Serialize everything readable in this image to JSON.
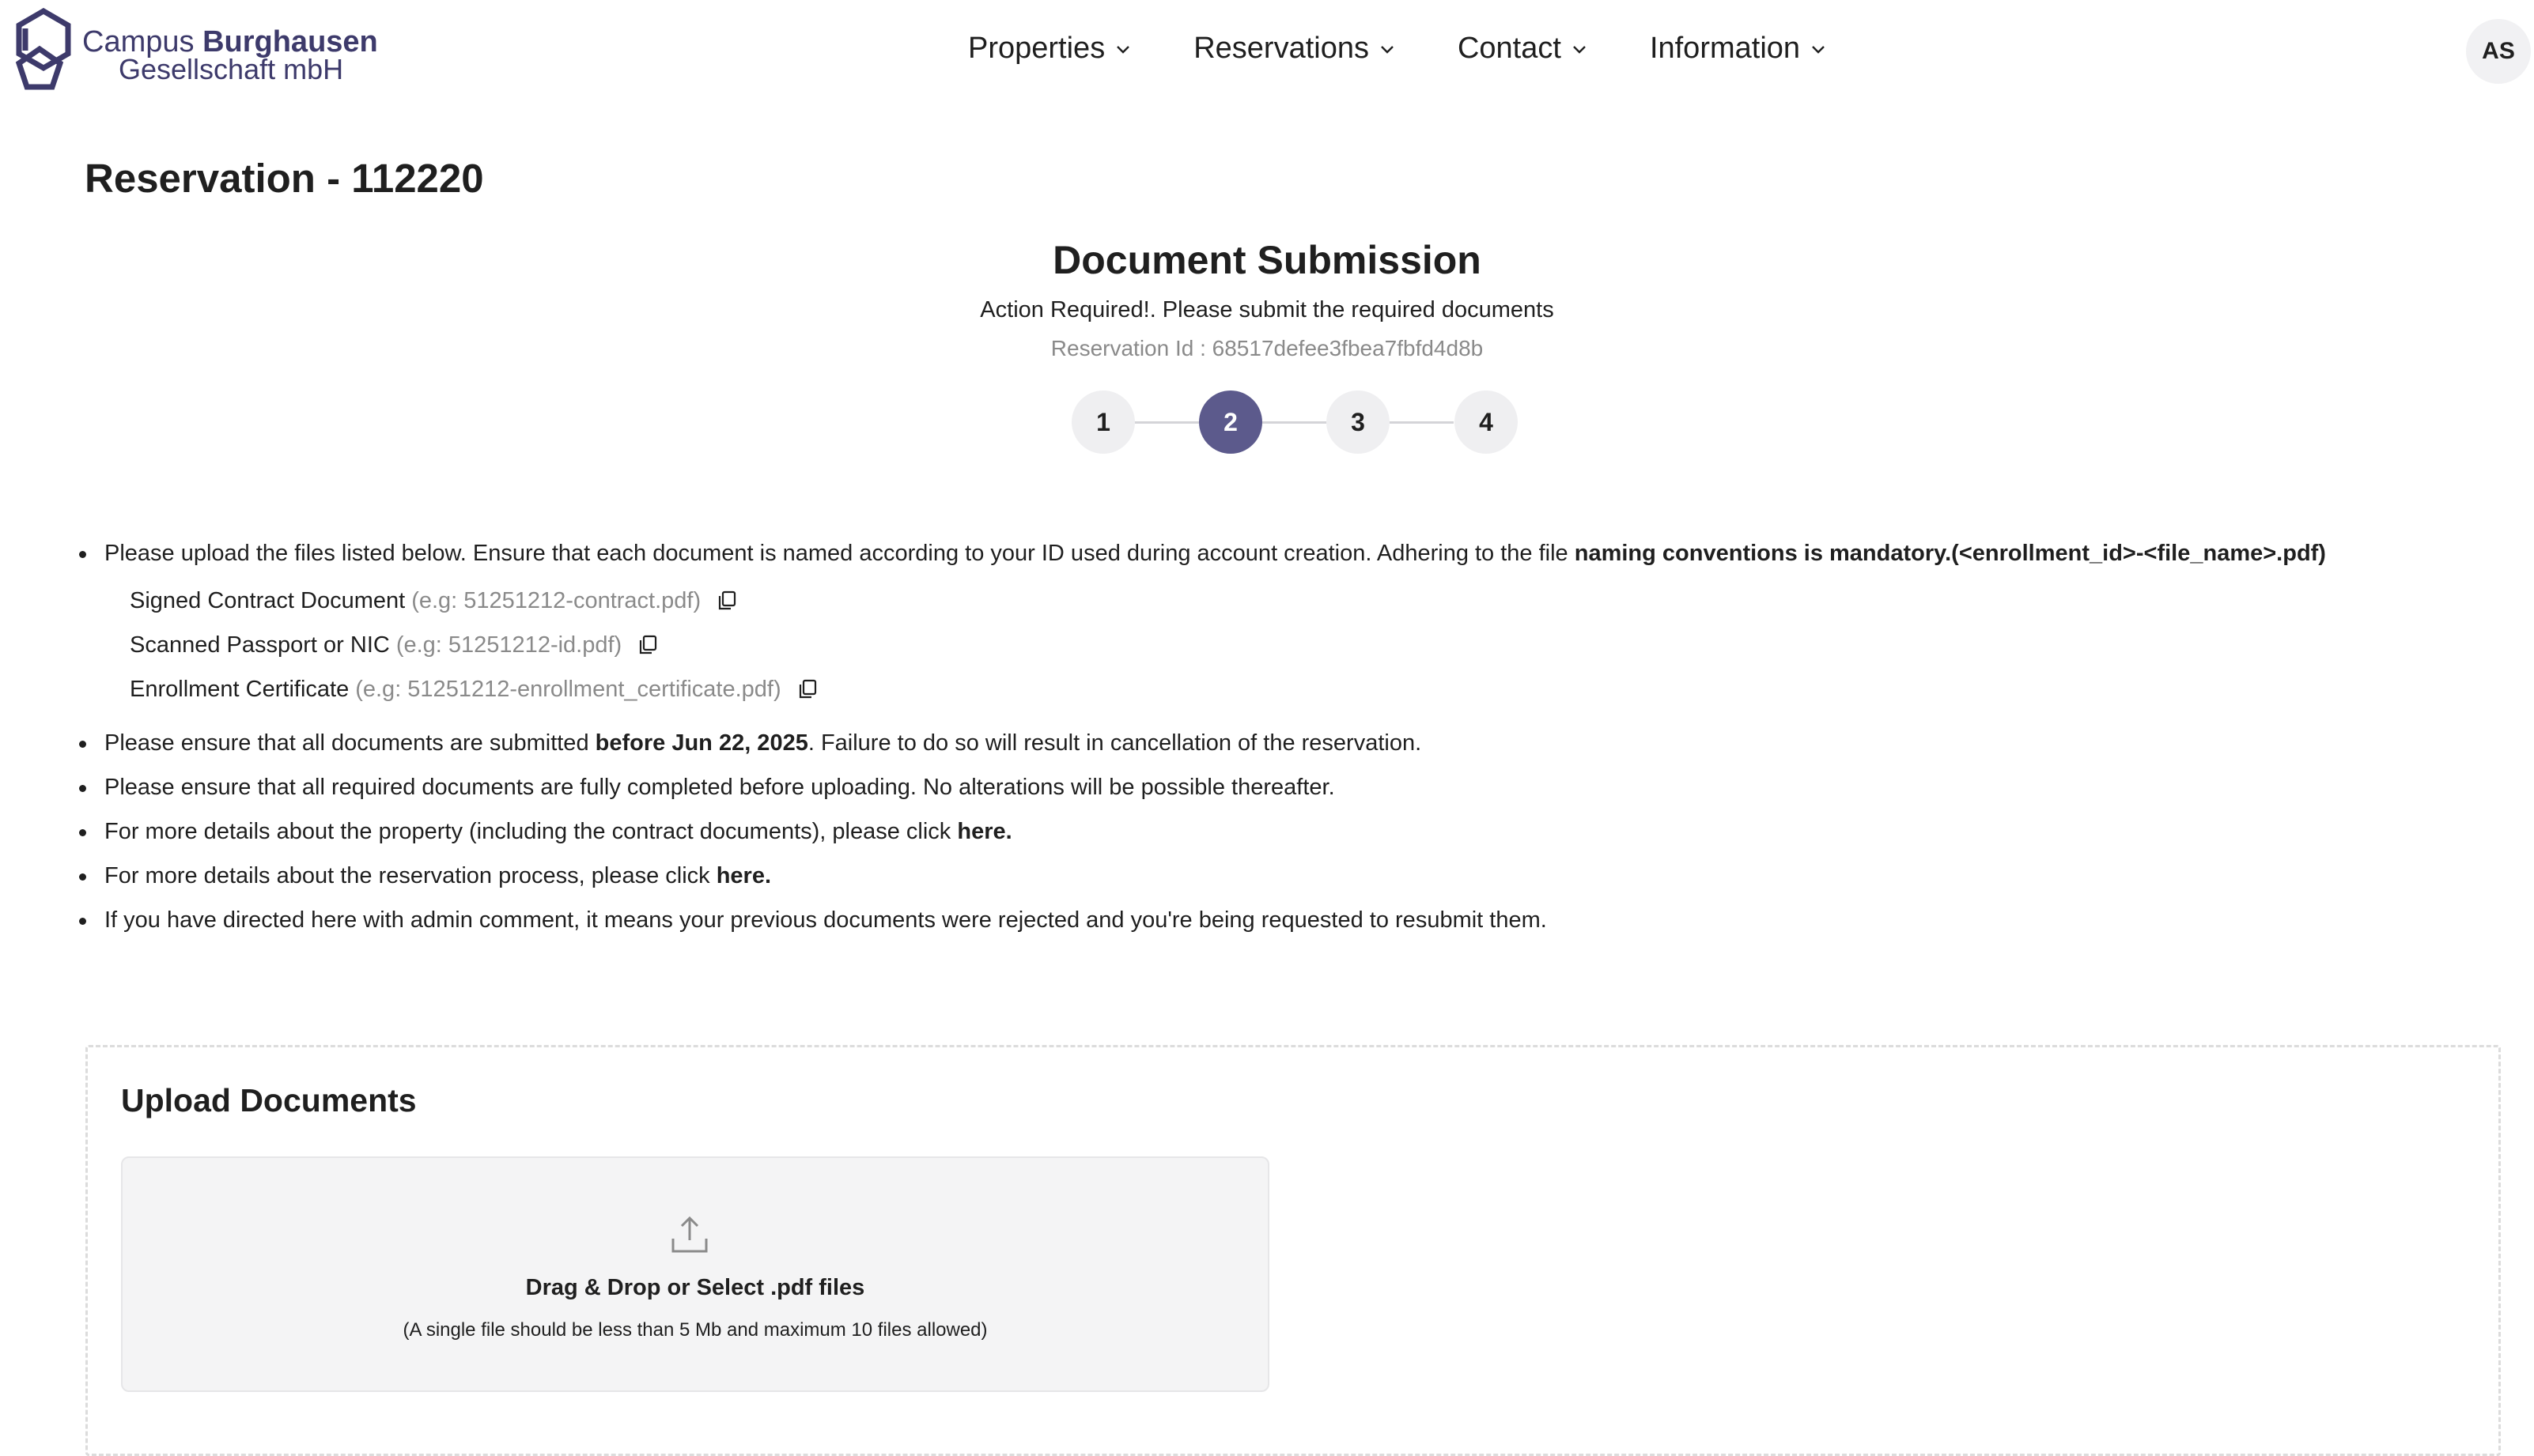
{
  "brand": {
    "line1_prefix": "Campus",
    "line1_bold": "Burghausen",
    "line2": "Gesellschaft mbH",
    "color": "#3d3a6b"
  },
  "nav": {
    "items": [
      {
        "label": "Properties"
      },
      {
        "label": "Reservations"
      },
      {
        "label": "Contact"
      },
      {
        "label": "Information"
      }
    ]
  },
  "user": {
    "initials": "AS"
  },
  "page": {
    "title": "Reservation - 112220"
  },
  "submission": {
    "title": "Document Submission",
    "subtitle": "Action Required!. Please submit the required documents",
    "reservation_id_text": "Reservation Id : 68517defee3fbea7fbfd4d8b"
  },
  "stepper": {
    "steps": [
      "1",
      "2",
      "3",
      "4"
    ],
    "active_step": 2,
    "active_color": "#5c5a8c"
  },
  "instructions": {
    "intro": "Please upload the files listed below. Ensure that each document is named according to your ID used during account creation. Adhering to the file ",
    "intro_bold": "naming conventions is mandatory.(<enrollment_id>-<file_name>.pdf)",
    "documents": [
      {
        "name": "Signed Contract Document",
        "example": "(e.g: 51251212-contract.pdf)"
      },
      {
        "name": "Scanned Passport or NIC",
        "example": "(e.g: 51251212-id.pdf)"
      },
      {
        "name": "Enrollment Certificate",
        "example": "(e.g: 51251212-enrollment_certificate.pdf)"
      }
    ],
    "deadline_prefix": "Please ensure that all documents are submitted ",
    "deadline_bold": "before Jun 22, 2025",
    "deadline_suffix": ". Failure to do so will result in cancellation of the reservation.",
    "completed_note": "Please ensure that all required documents are fully completed before uploading. No alterations will be possible thereafter.",
    "property_prefix": "For more details about the property (including the contract documents), please click ",
    "property_link": "here.",
    "process_prefix": "For more details about the reservation process, please click ",
    "process_link": "here.",
    "admin_note": "If you have directed here with admin comment, it means your previous documents were rejected and you're being requested to resubmit them."
  },
  "upload": {
    "title": "Upload Documents",
    "drop_label": "Drag & Drop or Select .pdf files",
    "drop_note": "(A single file should be less than 5 Mb and maximum 10 files allowed)"
  }
}
